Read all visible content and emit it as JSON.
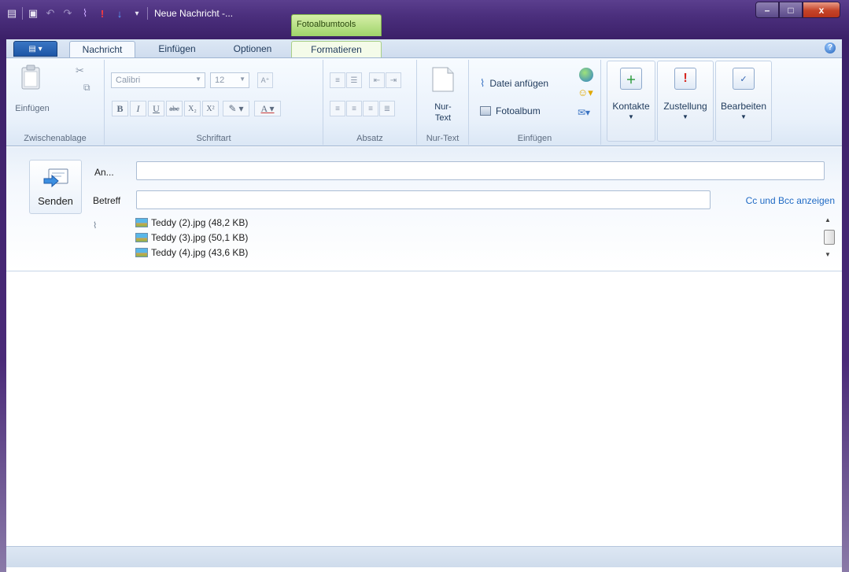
{
  "window": {
    "title": "Neue Nachricht -...",
    "context_tab": "Fotoalbumtools",
    "controls": {
      "minimize": "–",
      "maximize": "□",
      "close": "x"
    }
  },
  "tabs": [
    {
      "label": "Nachricht",
      "active": true
    },
    {
      "label": "Einfügen",
      "active": false
    },
    {
      "label": "Optionen",
      "active": false
    },
    {
      "label": "Formatieren",
      "active": false
    }
  ],
  "ribbon": {
    "clipboard": {
      "paste_label": "Einfügen",
      "group": "Zwischenablage"
    },
    "font": {
      "family": "Calibri",
      "size": "12",
      "group": "Schriftart"
    },
    "paragraph": {
      "group": "Absatz"
    },
    "plaintext": {
      "label_line1": "Nur-",
      "label_line2": "Text",
      "group": "Nur-Text"
    },
    "insert": {
      "attach_file": "Datei anfügen",
      "photo_album": "Fotoalbum",
      "group": "Einfügen"
    },
    "contacts": "Kontakte",
    "delivery": "Zustellung",
    "edit": "Bearbeiten"
  },
  "compose": {
    "send": "Senden",
    "to_label": "An...",
    "to_value": "",
    "subject_label": "Betreff",
    "subject_value": "",
    "cc_bcc_link": "Cc und Bcc anzeigen",
    "attachments": [
      "Teddy (2).jpg (48,2 KB)",
      "Teddy (3).jpg (50,1 KB)",
      "Teddy (4).jpg (43,6 KB)"
    ]
  },
  "colors": {
    "title_bar": "#4b2f7d",
    "context_tab": "#9fd36a",
    "file_button": "#1d56a6",
    "link": "#1f6ac4"
  }
}
